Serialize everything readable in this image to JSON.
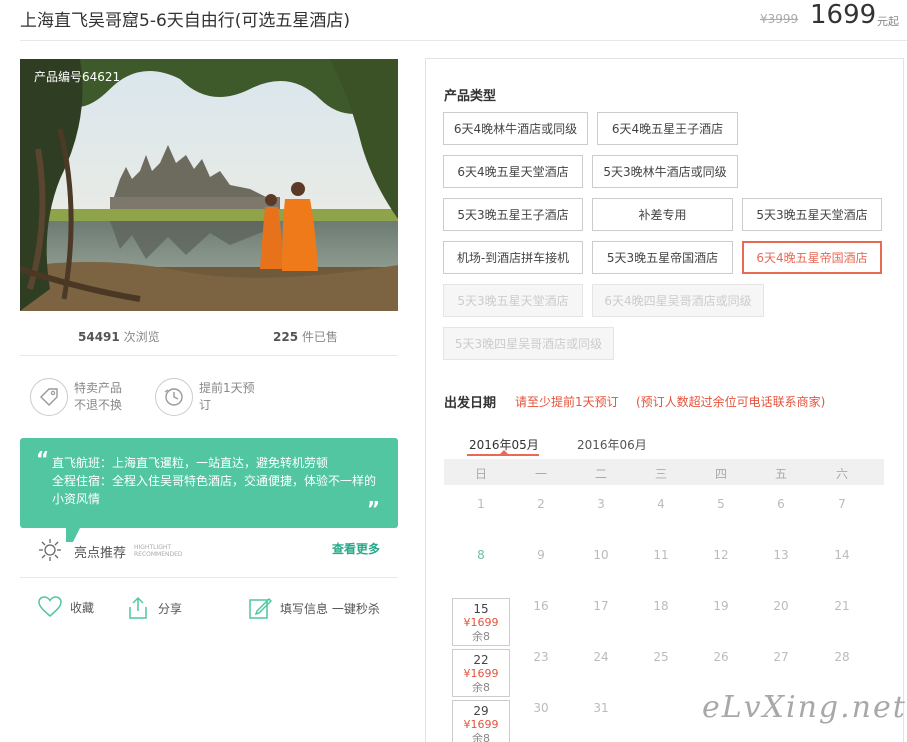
{
  "header": {
    "title": "上海直飞吴哥窟5-6天自由行(可选五星酒店)",
    "original_price": "¥3999",
    "price": "1699",
    "price_unit": "元起"
  },
  "photo": {
    "product_no": "产品编号64621"
  },
  "stats": {
    "views": "54491",
    "views_label": "次浏览",
    "sold": "225",
    "sold_label": "件已售"
  },
  "features": [
    {
      "icon": "tag-icon",
      "line1": "特卖产品",
      "line2": "不退不换"
    },
    {
      "icon": "clock-icon",
      "line1": "提前1天预",
      "line2": "订"
    }
  ],
  "highlight_box": {
    "quote_open": "“",
    "quote_close": "”",
    "line1": "直飞航班：上海直飞暹粒，一站直达，避免转机劳顿",
    "line2": "全程住宿：全程入住吴哥特色酒店，交通便捷，体验不一样的小资风情"
  },
  "highlight": {
    "label": "亮点推荐",
    "en1": "HIGHTLIGHT",
    "en2": "RECOMMENDED",
    "more": "查看更多"
  },
  "actions": {
    "collect": "收藏",
    "share": "分享",
    "fill": "填写信息 一键秒杀"
  },
  "product_type": {
    "label": "产品类型",
    "options": [
      {
        "text": "6天4晚林牛酒店或同级",
        "state": "normal"
      },
      {
        "text": "6天4晚五星王子酒店",
        "state": "normal"
      },
      {
        "text": "6天4晚五星天堂酒店",
        "state": "normal"
      },
      {
        "text": "5天3晚林牛酒店或同级",
        "state": "normal"
      },
      {
        "text": "5天3晚五星王子酒店",
        "state": "normal"
      },
      {
        "text": "补差专用",
        "state": "normal"
      },
      {
        "text": "5天3晚五星天堂酒店",
        "state": "normal"
      },
      {
        "text": "机场-到酒店拼车接机",
        "state": "normal"
      },
      {
        "text": "5天3晚五星帝国酒店",
        "state": "normal"
      },
      {
        "text": "6天4晚五星帝国酒店",
        "state": "selected"
      },
      {
        "text": "5天3晚五星天堂酒店",
        "state": "disabled"
      },
      {
        "text": "6天4晚四星吴哥酒店或同级",
        "state": "disabled"
      },
      {
        "text": "5天3晚四星吴哥酒店或同级",
        "state": "disabled"
      }
    ]
  },
  "departure": {
    "label": "出发日期",
    "note1": "请至少提前1天预订",
    "note2": "(预订人数超过余位可电话联系商家)"
  },
  "calendar": {
    "months": [
      "2016年05月",
      "2016年06月"
    ],
    "weekdays": [
      "日",
      "一",
      "二",
      "三",
      "四",
      "五",
      "六"
    ],
    "rows": [
      [
        "1",
        "2",
        "3",
        "4",
        "5",
        "6",
        "7"
      ],
      [
        "8",
        "9",
        "10",
        "11",
        "12",
        "13",
        "14"
      ],
      [
        "15",
        "16",
        "17",
        "18",
        "19",
        "20",
        "21"
      ],
      [
        "22",
        "23",
        "24",
        "25",
        "26",
        "27",
        "28"
      ],
      [
        "29",
        "30",
        "31"
      ]
    ],
    "available": [
      {
        "day": "15",
        "price": "¥1699",
        "remain": "余8"
      },
      {
        "day": "22",
        "price": "¥1699",
        "remain": "余8"
      },
      {
        "day": "29",
        "price": "¥1699",
        "remain": "余8"
      }
    ]
  },
  "watermark": "eLvXing.net"
}
